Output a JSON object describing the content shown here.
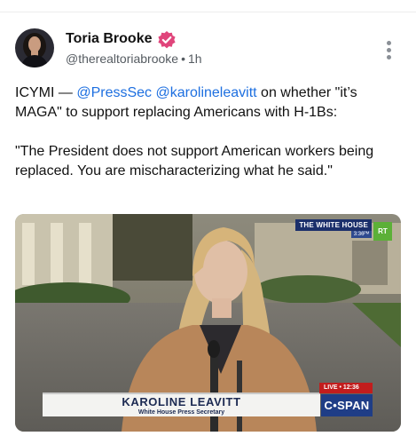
{
  "post": {
    "author": {
      "display_name": "Toria Brooke",
      "handle": "@therealtoriabrooke",
      "separator": "•",
      "time_ago": "1h",
      "verified": true,
      "avatar_icon": "profile-photo"
    },
    "more_icon": "vertical-ellipsis-icon",
    "text": {
      "line1_prefix": "ICYMI — ",
      "mention1": "@PressSec",
      "mention2": "@karolineleavitt",
      "line1_suffix": " on whether \"it’s MAGA\" to support replacing Americans with H-1Bs:",
      "quote": "\"The President does not support American workers being replaced. You are mischaracterizing what he said.\""
    },
    "media": {
      "channel_bug": "THE WHITE HOUSE",
      "channel_time": "3:36ᴾᴹ",
      "rt_logo": "RT",
      "lower_third_name": "KAROLINE LEAVITT",
      "lower_third_title": "White House Press Secretary",
      "live_label": "LIVE • 12:36",
      "network": "C•SPAN"
    }
  },
  "colors": {
    "mention": "#1d6fe0",
    "verified_badge": "#e0457b",
    "cspan_blue": "#1f3d86",
    "live_red": "#c21d1d"
  }
}
